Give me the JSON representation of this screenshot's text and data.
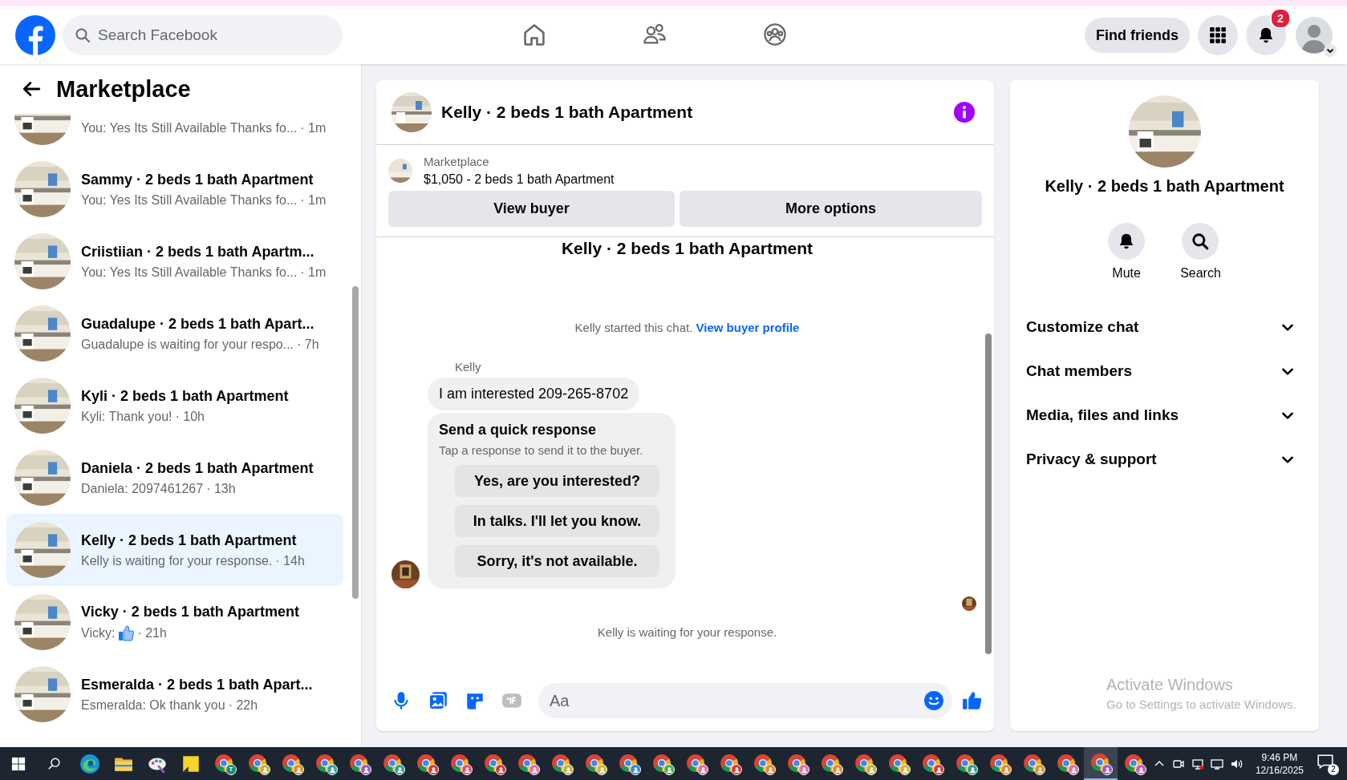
{
  "top_bar": {
    "search": {
      "placeholder": "Search Facebook"
    },
    "nav": [
      {
        "kind": "home",
        "selected": false
      },
      {
        "kind": "friends",
        "selected": false
      },
      {
        "kind": "groups",
        "selected": false
      }
    ],
    "find_friends": "Find friends",
    "notifications_badge": "2"
  },
  "sidebar": {
    "title": "Marketplace",
    "conversations": [
      {
        "kind": "text",
        "preview": "You: Yes Its Still Available Thanks fo...",
        "time": "· 1m",
        "selected": false
      },
      {
        "kind": "text",
        "title": "Sammy · 2 beds 1 bath Apartment",
        "preview": "You: Yes Its Still Available Thanks fo...",
        "time": "· 1m",
        "selected": false
      },
      {
        "kind": "text",
        "title": "Criistiian · 2 beds 1 bath Apartm...",
        "preview": "You: Yes Its Still Available Thanks fo...",
        "time": "· 1m",
        "selected": false
      },
      {
        "kind": "text",
        "title": "Guadalupe · 2 beds 1 bath Apart...",
        "preview": "Guadalupe is waiting for your respo...",
        "time": "· 7h",
        "selected": false
      },
      {
        "kind": "text",
        "title": "Kyli · 2 beds 1 bath Apartment",
        "preview": "Kyli: Thank you!",
        "time": "· 10h",
        "selected": false
      },
      {
        "kind": "text",
        "title": "Daniela · 2 beds 1 bath Apartment",
        "preview": "Daniela: 2097461267",
        "time": "· 13h",
        "selected": false
      },
      {
        "kind": "text",
        "title": "Kelly · 2 beds 1 bath Apartment",
        "preview": "Kelly is waiting for your response.",
        "time": "· 14h",
        "selected": true
      },
      {
        "kind": "like",
        "title": "Vicky · 2 beds 1 bath Apartment",
        "preview": "Vicky:",
        "time": "· 21h",
        "selected": false
      },
      {
        "kind": "text",
        "title": "Esmeralda · 2 beds 1 bath Apart...",
        "preview": "Esmeralda: Ok thank you",
        "time": "· 22h",
        "selected": false
      }
    ]
  },
  "chat": {
    "title": "Kelly · 2 beds 1 bath Apartment",
    "listing": {
      "source": "Marketplace",
      "summary": "$1,050 - 2 beds 1 bath Apartment"
    },
    "buttons": [
      "View buyer",
      "More options"
    ],
    "thread_title": "Kelly · 2 beds 1 bath Apartment",
    "started_note": "Kelly started this chat.",
    "profile_link": "View buyer profile",
    "sender": "Kelly",
    "message": "I am interested 209-265-8702",
    "quick_response": {
      "title": "Send a quick response",
      "hint": "Tap a response to send it to the buyer.",
      "options": [
        "Yes, are you interested?",
        "In talks. I'll let you know.",
        "Sorry, it's not available."
      ]
    },
    "status": "Kelly is waiting for your response.",
    "composer": {
      "placeholder": "Aa"
    }
  },
  "details": {
    "name": "Kelly · 2 beds 1 bath Apartment",
    "actions": [
      {
        "kind": "bell",
        "label": "Mute"
      },
      {
        "kind": "search",
        "label": "Search"
      }
    ],
    "sections": [
      {
        "label": "Customize chat",
        "expanded": false
      },
      {
        "label": "Chat members",
        "expanded": false
      },
      {
        "label": "Media, files and links",
        "expanded": false
      },
      {
        "label": "Privacy & support",
        "expanded": false
      }
    ]
  },
  "os_notice": {
    "title": "Activate Windows",
    "text": "Go to Settings to activate Windows."
  },
  "taskbar": {
    "apps": [
      {
        "kind": "edge",
        "selected": false
      },
      {
        "kind": "folder",
        "selected": false
      },
      {
        "kind": "paint",
        "selected": false
      },
      {
        "kind": "notes",
        "selected": false
      },
      {
        "kind": "chrome",
        "badge_text": "T",
        "color": "#1b8a7a",
        "selected": false
      },
      {
        "kind": "chrome",
        "color": "#c9b037",
        "selected": false
      },
      {
        "kind": "chrome",
        "color": "#e8892c",
        "selected": false
      },
      {
        "kind": "chrome",
        "color": "#3aa0b8",
        "selected": false
      },
      {
        "kind": "chrome",
        "color": "#9a5cc6",
        "selected": false
      },
      {
        "kind": "chrome",
        "color": "#2fa39a",
        "selected": false
      },
      {
        "kind": "chrome",
        "color": "#d93a3a",
        "selected": false
      },
      {
        "kind": "chrome",
        "color": "#e0527a",
        "selected": false
      },
      {
        "kind": "chrome",
        "color": "#d93a3a",
        "selected": false
      },
      {
        "kind": "chrome",
        "color": "#e86fa8",
        "selected": false
      },
      {
        "kind": "chrome",
        "color": "#c9b037",
        "selected": false
      },
      {
        "kind": "chrome",
        "color": "#d4b43a",
        "selected": false
      },
      {
        "kind": "chrome",
        "color": "#3a8ad9",
        "selected": false
      },
      {
        "kind": "chrome",
        "color": "#4caf50",
        "selected": false
      },
      {
        "kind": "chrome",
        "color": "#e86fa8",
        "selected": false
      },
      {
        "kind": "chrome",
        "color": "#d93a3a",
        "selected": false
      },
      {
        "kind": "chrome",
        "color": "#e8892c",
        "selected": false
      },
      {
        "kind": "chrome",
        "color": "#e86fa8",
        "selected": false
      },
      {
        "kind": "chrome",
        "color": "#e8892c",
        "selected": false
      },
      {
        "kind": "chrome",
        "color": "#c9b037",
        "selected": false
      },
      {
        "kind": "chrome",
        "color": "#d4b43a",
        "selected": false
      },
      {
        "kind": "chrome",
        "color": "#d93a3a",
        "selected": false
      },
      {
        "kind": "chrome",
        "color": "#2fa39a",
        "selected": false
      },
      {
        "kind": "chrome",
        "color": "#e8892c",
        "selected": false
      },
      {
        "kind": "chrome",
        "color": "#e0922c",
        "selected": false
      },
      {
        "kind": "chrome",
        "color": "#e86fa8",
        "selected": false
      },
      {
        "kind": "chrome",
        "color": "#9a5cc6",
        "selected": true
      },
      {
        "kind": "chrome",
        "color": "#c65cb8",
        "selected": false
      }
    ],
    "time": "9:46 PM",
    "date": "12/16/2025",
    "notification_count": "2"
  }
}
